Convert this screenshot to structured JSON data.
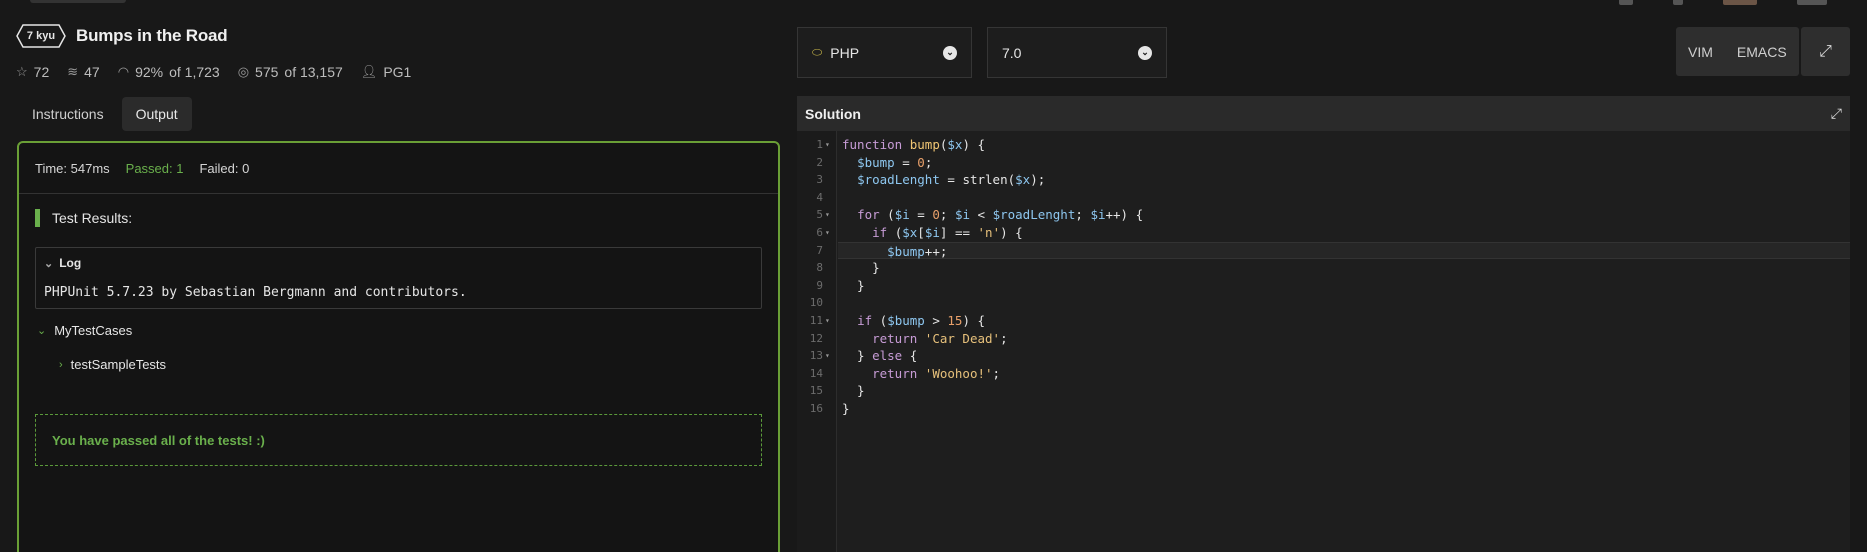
{
  "kata": {
    "rank": "7 kyu",
    "title": "Bumps in the Road",
    "stats": {
      "stars": "72",
      "collections": "47",
      "satisfaction": "92%",
      "satisfaction_of": "of 1,723",
      "completed": "575",
      "completed_of": "of 13,157",
      "author": "PG1"
    }
  },
  "tabs": [
    {
      "label": "Instructions",
      "active": false
    },
    {
      "label": "Output",
      "active": true
    }
  ],
  "output": {
    "time": "Time: 547ms",
    "passed": "Passed: 1",
    "failed": "Failed: 0",
    "results_title": "Test Results:",
    "log_title": "Log",
    "log_text": "PHPUnit 5.7.23 by Sebastian Bergmann and contributors.",
    "suite_name": "MyTestCases",
    "case_name": "testSampleTests",
    "pass_message": "You have passed all of the tests! :)"
  },
  "editor_controls": {
    "language": "PHP",
    "version": "7.0",
    "keymaps": [
      "VIM",
      "EMACS"
    ]
  },
  "solution": {
    "title": "Solution",
    "lines": [
      "function bump($x) {",
      "  $bump = 0;",
      "  $roadLenght = strlen($x);",
      "",
      "  for ($i = 0; $i < $roadLenght; $i++) {",
      "    if ($x[$i] == 'n') {",
      "      $bump++;",
      "    }",
      "  }",
      "",
      "  if ($bump > 15) {",
      "    return 'Car Dead';",
      "  } else {",
      "    return 'Woohoo!';",
      "  }",
      "}"
    ],
    "fold_lines": [
      1,
      5,
      6,
      11,
      13
    ],
    "highlighted_line": 7
  },
  "colors": {
    "pass_green": "#6ab04c",
    "panel_border": "#6a9f36",
    "background": "#181818"
  }
}
